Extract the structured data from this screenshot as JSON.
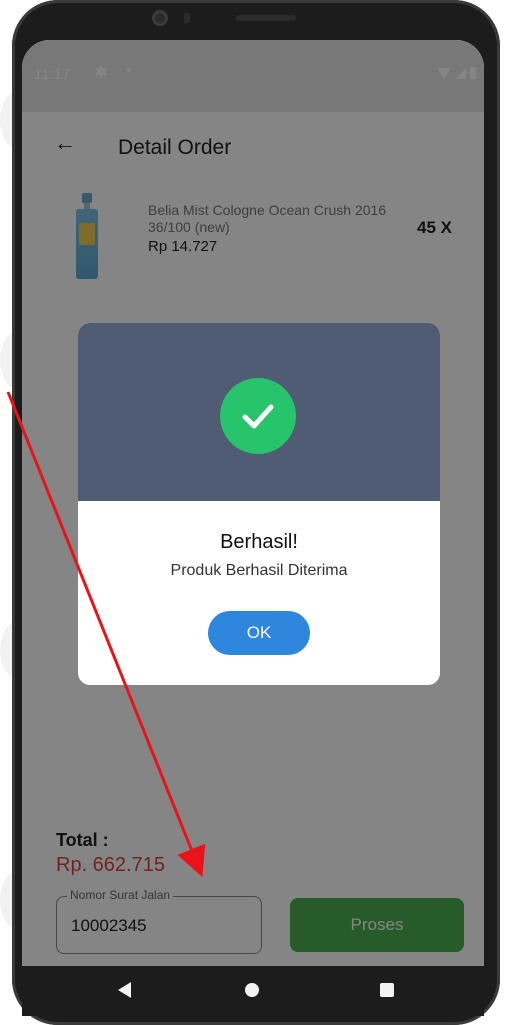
{
  "status_bar": {
    "time": "11:17",
    "settings_icon": "gear-icon",
    "dot": "•"
  },
  "app_bar": {
    "back_icon": "arrow-left-icon",
    "back_glyph": "←",
    "title": "Detail Order"
  },
  "product": {
    "name": "Belia Mist Cologne Ocean Crush 2016 36/100 (new)",
    "price": "Rp 14.727",
    "quantity": "45 X"
  },
  "total": {
    "label": "Total :",
    "value": "Rp. 662.715"
  },
  "delivery_note": {
    "label": "Nomor Surat Jalan",
    "value": "10002345"
  },
  "process_button": {
    "label": "Proses"
  },
  "dialog": {
    "icon": "check-circle-icon",
    "title": "Berhasil!",
    "message": "Produk Berhasil Diterima",
    "ok_label": "OK"
  },
  "colors": {
    "dialog_header": "#4f5c73",
    "success_green": "#28c46c",
    "ok_blue": "#2f86dd",
    "total_red": "#d9453a",
    "proses_green": "#4caf50",
    "annotation_arrow": "#e8141a"
  }
}
